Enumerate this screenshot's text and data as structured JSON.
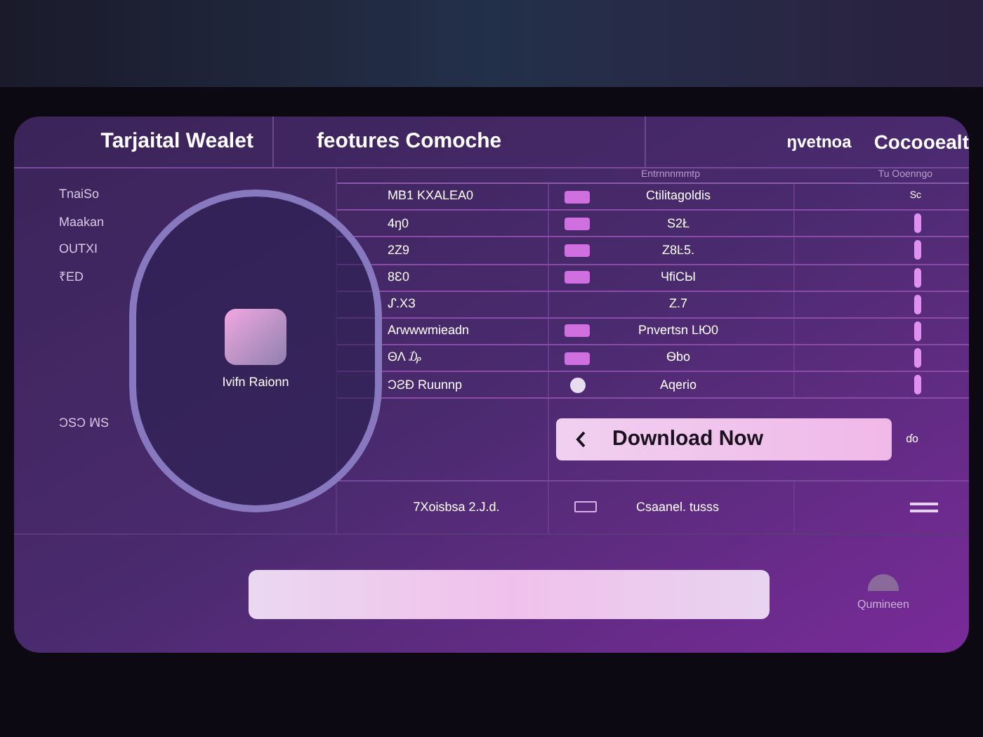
{
  "header": {
    "title": "Tarjaital Wealet",
    "features": "feotures Comoche",
    "version": "ŋvetnoa",
    "contact": "Cocooealt"
  },
  "subheader": {
    "column_3": "Entrnnnmmtp",
    "column_4": "Tu Ooenngo"
  },
  "side_labels": [
    "TnaiSo",
    "Maakan",
    "OUTXI",
    "₹ED"
  ],
  "side_footer": "ƆSƆ ꟽS",
  "app_label": "Ivifn Raionn",
  "rows": [
    {
      "column_2": "MB1 KXALEA0",
      "kind": "tray",
      "column_3": "Ctilitagoldis",
      "column_4": "Sc"
    },
    {
      "column_2": "4ŋ0",
      "kind": "tray",
      "column_3": "S2Ł"
    },
    {
      "column_2": "2Z9",
      "kind": "tray",
      "column_3": "Z8Ŀ5."
    },
    {
      "column_2": "8Ɛ0",
      "kind": "tray",
      "column_3": "ЧfiCЫ"
    },
    {
      "column_2": "ᔑ.XЗ",
      "kind": "none",
      "column_3": "Z.7"
    },
    {
      "column_2": "Arwwwmieadn",
      "kind": "tray",
      "column_3": "Pnvertsn LЮ0"
    },
    {
      "column_2": "ΘΛ ₯",
      "kind": "tray",
      "column_3": "Ѳbo"
    },
    {
      "column_2": "ƆƧƉ Ruunnp",
      "kind": "smiley",
      "column_3": "Aqerio"
    }
  ],
  "download_button": "Download Now",
  "download_note": "ɗo",
  "extra_row": {
    "column_2": "7Xoisbsa 2.J.d.",
    "column_3": "Csaanel. tusss"
  },
  "footer_label": "Qumineen"
}
